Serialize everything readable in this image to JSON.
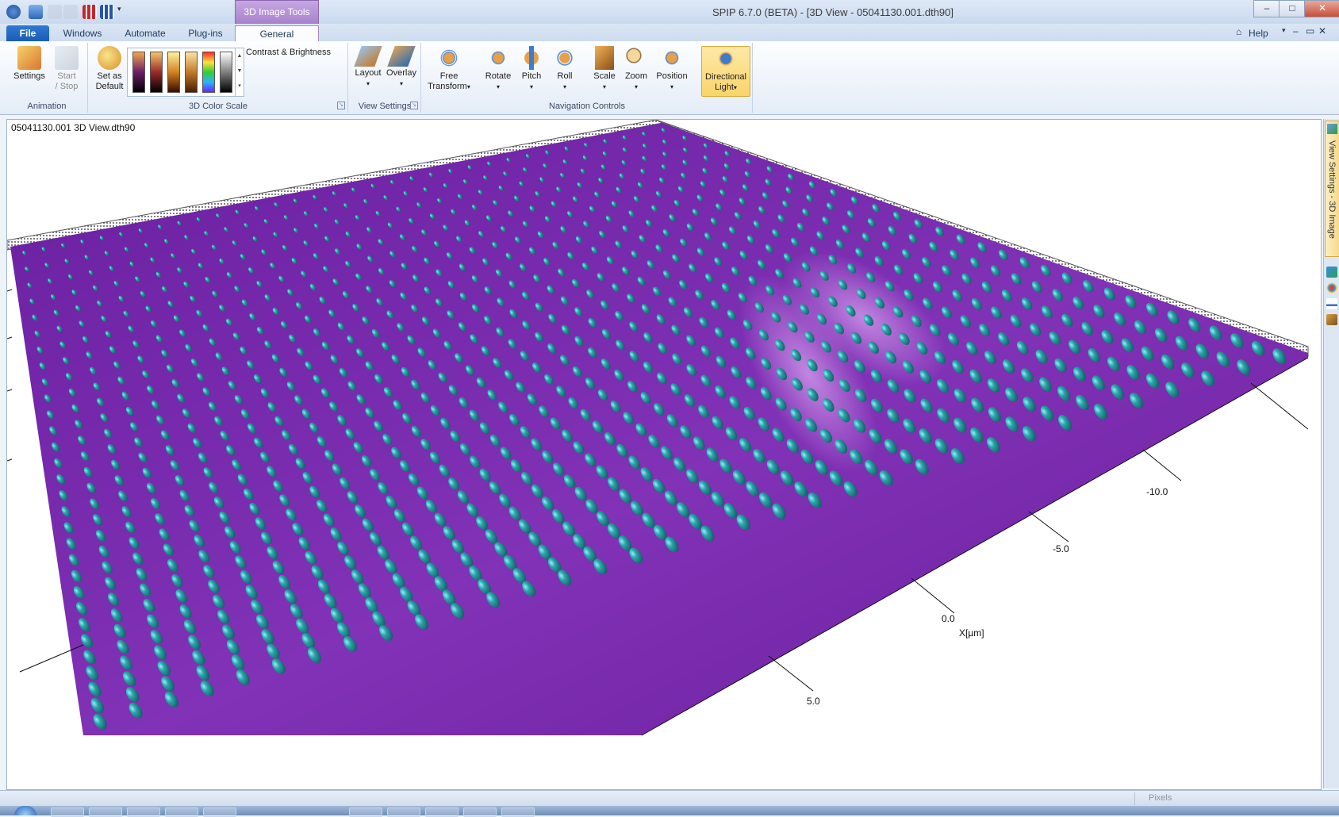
{
  "titlebar": {
    "title": "SPIP 6.7.0 (BETA) - [3D View - 05041130.001.dth90]",
    "minimize": "–",
    "maximize": "□",
    "close": "✕"
  },
  "ribbon_tabs": {
    "contextual_header": "3D Image Tools",
    "file": "File",
    "windows": "Windows",
    "automate": "Automate",
    "plugins": "Plug-ins",
    "general": "General",
    "help": "Help"
  },
  "ribbon": {
    "animation": {
      "label": "Animation",
      "settings": "Settings",
      "start_stop_line1": "Start",
      "start_stop_line2": "/ Stop"
    },
    "color_scale": {
      "label": "3D Color Scale",
      "set_default_line1": "Set as",
      "set_default_line2": "Default",
      "contrast": "Contrast & Brightness"
    },
    "view_settings": {
      "label": "View Settings",
      "layout": "Layout",
      "overlay": "Overlay"
    },
    "navigation": {
      "label": "Navigation Controls",
      "free_transform_line1": "Free",
      "free_transform_line2": "Transform",
      "rotate": "Rotate",
      "pitch": "Pitch",
      "roll": "Roll",
      "scale": "Scale",
      "zoom": "Zoom",
      "position": "Position",
      "directional_light_line1": "Directional",
      "directional_light_line2": "Light"
    }
  },
  "view": {
    "title": "05041130.001 3D View.dth90",
    "axis": {
      "ticks": [
        "-10.0",
        "-5.0",
        "0.0",
        "5.0"
      ],
      "label": "X[µm]"
    },
    "surface_color": "#7a2aa8",
    "bump_color": "#1f8c8a"
  },
  "side_panel": {
    "tab_label": "View Settings - 3D Image"
  },
  "status": {
    "pixels": "Pixels"
  }
}
